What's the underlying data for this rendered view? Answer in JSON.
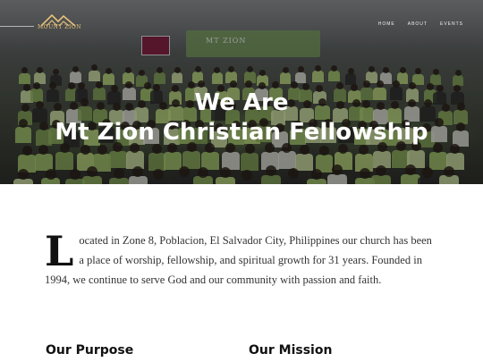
{
  "header": {
    "logo_text": "MOUNT ZION",
    "nav": [
      "HOME",
      "ABOUT",
      "EVENTS"
    ]
  },
  "hero": {
    "banner_text": "MT ZION",
    "title_line1": "We Are",
    "title_line2": "Mt Zion Christian Fellowship"
  },
  "intro": {
    "drop_cap": "L",
    "text": "ocated in Zone 8, Poblacion, El Salvador City, Philippines our church has been a place of worship, fellowship, and spiritual growth for 31 years. Founded in 1994, we continue to serve God and our community with passion and faith."
  },
  "sections": {
    "purpose_heading": "Our Purpose",
    "mission_heading": "Our Mission"
  },
  "colors": {
    "logo_gold": "#e6c27a",
    "hero_text": "#ffffff",
    "body_text": "#333333"
  }
}
